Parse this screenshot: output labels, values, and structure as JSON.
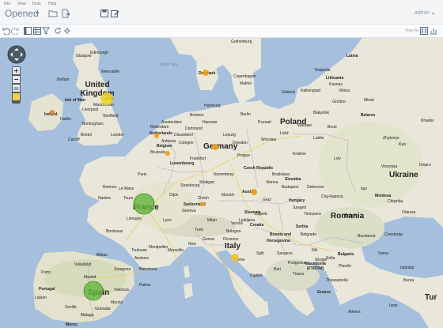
{
  "menu": {
    "file": "File",
    "view": "View",
    "tools": "Tools",
    "help": "Help"
  },
  "header": {
    "title": "Opened",
    "user": "admin"
  },
  "toolbar": {
    "view_as": "View As"
  },
  "map": {
    "countries_big": {
      "ukraine": "Ukraine",
      "romania": "Romania",
      "poland": "Poland",
      "germany": "Germany",
      "france": "France",
      "spain": "Spain",
      "italy": "Italy",
      "united_kingdom": "United Kingdom",
      "turkey": "Tur"
    },
    "countries_small": {
      "latvia": "Latvia",
      "lithuania": "Lithuania",
      "belarus": "Belarus",
      "ireland": "Ireland",
      "portugal": "Portugal",
      "czech": "Czech Republic",
      "slovakia": "Slovakia",
      "austria": "Austria",
      "hungary": "Hungary",
      "switzerland": "Switzerland",
      "croatia": "Croatia",
      "bosnia": "Bosnia and",
      "herzegovina": "Herzegovina",
      "serbia": "Serbia",
      "bulgaria": "Bulgaria",
      "greece": "Greece",
      "macedonia": "Macedonia",
      "fyrom": "(FYROM)",
      "moldova": "Moldova",
      "netherlands": "Netherlands",
      "belgium": "Belgium",
      "luxembourg": "Luxembourg",
      "denmark": "Denmark",
      "slovenia": "Slovenia",
      "isle_of_man": "Isle of Man",
      "morocco": "Moroc"
    },
    "seas": {
      "north_sea": "North Sea"
    },
    "cities": {
      "gothenburg": "Gothenburg",
      "copenhagen": "Copenhagen",
      "malmo": "Malmö",
      "hamburg": "Hamburg",
      "bremen": "Bremen",
      "hanover": "Hanover",
      "berlin": "Berlin",
      "poznan": "Poznań",
      "gdansk": "Gdańsk",
      "kaliningrad": "Kaliningrad",
      "klaipeda": "Klaipėda",
      "vilnius": "Vilnius",
      "kaunas": "Kaunas",
      "minsk": "Minsk",
      "grodno": "Grodno",
      "bialystok": "Białystok",
      "warsaw": "Warsaw",
      "lodz": "Łódź",
      "lublin": "Lublin",
      "brest": "Brest",
      "dresden": "Dresden",
      "leipzig": "Leipzig",
      "wroclaw": "Wrocław",
      "krakow": "Kraków",
      "prague": "Prague",
      "kyiv": "Kyiv",
      "lviv": "Lviv",
      "zhytomyr": "Zhytomyr",
      "vinnytsia": "Vinnytsia",
      "kharkiv": "Kharkiv",
      "dnipro": "Dnipro",
      "chisinau": "Chișinău",
      "odessa": "Odessa",
      "iasi": "Iași",
      "cluj": "Cluj-Napoca",
      "debrecen": "Debrecen",
      "budapest": "Budapest",
      "szeged": "Szeged",
      "timisoara": "Timișoara",
      "bucharest": "Bucharest",
      "constanta": "Constanța",
      "brasov": "Brașov",
      "varna": "Varna",
      "sofia": "Sofia",
      "plovdiv": "Plovdiv",
      "nis": "Niš",
      "belgrade": "Belgrade",
      "sarajevo": "Sarajevo",
      "split": "Split",
      "zagreb": "Zagreb",
      "ljubljana": "Ljubljana",
      "graz": "Graz",
      "vienna": "Vienna",
      "bratislava": "Bratislava",
      "munich": "Munich",
      "nuremberg": "Nuremberg",
      "frankfurt": "Frankfurt",
      "cologne": "Cologne",
      "dusseldorf": "Düsseldorf",
      "dortmund": "Dortmund",
      "amsterdam": "Amsterdam",
      "rotterdam": "Rotterdam",
      "brussels": "Brussels",
      "antwerp": "Antwerp",
      "zurich": "Zürich",
      "stuttgart": "Stuttgart",
      "strasbourg": "Strasbourg",
      "paris": "Paris",
      "nantes": "Nantes",
      "rennes": "Rennes",
      "le_mans": "Le Mans",
      "tours": "Tours",
      "dijon": "Dijon",
      "lyon": "Lyon",
      "geneva": "Geneva",
      "milan": "Milan",
      "turin": "Turin",
      "venice": "Venice",
      "genoa": "Genoa",
      "nice": "Nice",
      "marseille": "Marseille",
      "montpellier": "Montpellier",
      "toulouse": "Toulouse",
      "bordeaux": "Bordeaux",
      "limoges": "Limoges",
      "florence": "Florence",
      "bologna": "Bologna",
      "rome": "Rome",
      "naples": "Naples",
      "bari": "Bari",
      "andorra": "Andorra",
      "barcelona": "Barcelona",
      "zaragoza": "Zaragoza",
      "bilbao": "Bilbao",
      "valladolid": "Valladolid",
      "madrid": "Madrid",
      "valencia": "Valencia",
      "palma": "Palma",
      "porto": "Porto",
      "lisbon": "Lisbon",
      "seville": "Seville",
      "malaga": "Málaga",
      "murcia": "Murcia",
      "granada": "Granada",
      "thessaloniki": "Thessaloniki",
      "tirana": "Tirana",
      "skopje": "Skopje",
      "podgorica": "Podgorica",
      "istanbul": "Istanbul",
      "bursa": "Bursa",
      "izmir": "İzmir",
      "athens": "Athens",
      "dublin": "Dublin",
      "liverpool": "Liverpool",
      "manchester": "Manchester",
      "leeds": "Leeds",
      "sheffield": "Sheffield",
      "birmingham": "Birmingham",
      "london": "London",
      "bristol": "Bristol",
      "cardiff": "Cardiff",
      "newcastle": "Newcastle",
      "glasgow": "Glasgow",
      "edinburgh": "Edinburgh",
      "belfast": "Belfast"
    }
  },
  "bubbles": [
    {
      "name": "France",
      "color": "#5fb63a",
      "size": "large"
    },
    {
      "name": "Spain",
      "color": "#5fb63a",
      "size": "large"
    },
    {
      "name": "United Kingdom",
      "color": "#f0d21e",
      "size": "medium"
    },
    {
      "name": "Italy",
      "color": "#f0c230",
      "size": "small"
    },
    {
      "name": "Germany",
      "color": "#f39c12",
      "size": "small"
    },
    {
      "name": "Austria",
      "color": "#f39c12",
      "size": "small"
    },
    {
      "name": "Denmark",
      "color": "#f39c12",
      "size": "small"
    },
    {
      "name": "Ireland",
      "color": "#f07a1a",
      "size": "small"
    },
    {
      "name": "Netherlands",
      "color": "#f39c12",
      "size": "small"
    },
    {
      "name": "Belgium",
      "color": "#f39c12",
      "size": "small"
    },
    {
      "name": "Switzerland",
      "color": "#f39c12",
      "size": "small"
    }
  ]
}
